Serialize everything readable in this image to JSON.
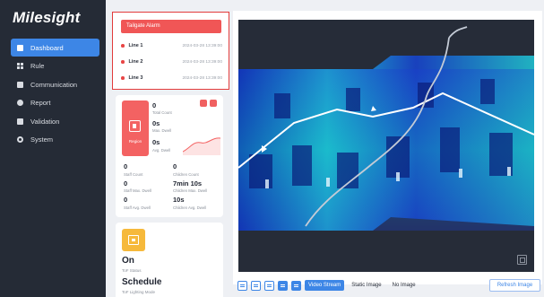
{
  "brand": "Milesight",
  "nav": [
    {
      "label": "Dashboard",
      "icon": "dashboard-icon",
      "active": true
    },
    {
      "label": "Rule",
      "icon": "rule-icon"
    },
    {
      "label": "Communication",
      "icon": "communication-icon"
    },
    {
      "label": "Report",
      "icon": "report-icon"
    },
    {
      "label": "Validation",
      "icon": "validation-icon"
    },
    {
      "label": "System",
      "icon": "system-icon"
    }
  ],
  "alarm": {
    "title": "Tailgate Alarm",
    "rows": [
      {
        "line": "Line 1",
        "time": "2024-03-28 13:39:00"
      },
      {
        "line": "Line 2",
        "time": "2024-03-28 13:39:00"
      },
      {
        "line": "Line 3",
        "time": "2024-03-28 13:39:00"
      }
    ]
  },
  "stats": {
    "region_label": "Region",
    "total_count": "0",
    "total_count_label": "Total Count",
    "max_dwell": "0s",
    "max_dwell_label": "Max. Dwell",
    "avg_dwell": "0s",
    "avg_dwell_label": "Avg. Dwell",
    "staff_count": "0",
    "staff_count_label": "Staff Count",
    "children_count": "0",
    "children_count_label": "Children Count",
    "staff_max_dwell": "0",
    "staff_max_dwell_label": "Staff Max. Dwell",
    "children_max_dwell": "7min 10s",
    "children_max_dwell_label": "Children Max. Dwell",
    "staff_avg_dwell": "0",
    "staff_avg_dwell_label": "Staff Avg. Dwell",
    "children_avg_dwell": "10s",
    "children_avg_dwell_label": "Children Avg. Dwell"
  },
  "tof": {
    "status": "On",
    "status_label": "ToF Status",
    "mode": "Schedule",
    "mode_label": "ToF Lighting Mode"
  },
  "toolbar": {
    "video_stream": "Video Stream",
    "static_image": "Static Image",
    "no_image": "No Image",
    "refresh": "Refresh Image"
  },
  "colors": {
    "accent": "#3d86e6",
    "alarm": "#f05656",
    "sidebar": "#252b36",
    "tof": "#f6b93b"
  }
}
